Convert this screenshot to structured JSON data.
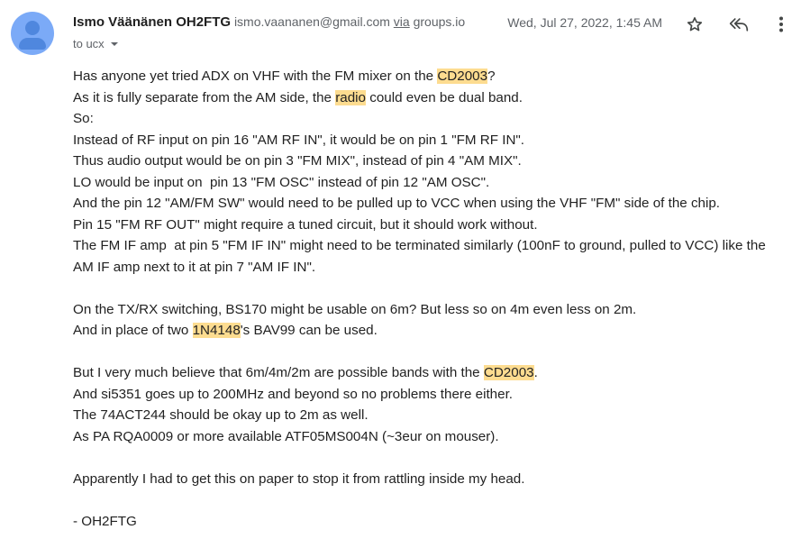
{
  "header": {
    "sender_name": "Ismo Väänänen OH2FTG",
    "sender_email": "ismo.vaananen@gmail.com",
    "via_word": "via",
    "via_domain": "groups.io",
    "date": "Wed, Jul 27, 2022, 1:45 AM",
    "to_label": "to ucx"
  },
  "icons": {
    "avatar": "person-avatar",
    "star": "star-icon",
    "reply": "reply-all-icon",
    "more": "more-vert-icon",
    "details": "chevron-down-icon"
  },
  "colors": {
    "highlight": "#fddc90",
    "avatar_bg": "#7baaf7",
    "avatar_fg": "#4f87de",
    "muted_text": "#5f6368"
  },
  "body": {
    "l1": [
      "Has anyone yet tried ADX on VHF with the FM mixer on the ",
      "CD2003",
      "?"
    ],
    "l2": [
      "As it is fully separate from the AM side, the ",
      "radio",
      " could even be dual band."
    ],
    "l3": "So:",
    "l4": "Instead of RF input on pin 16 \"AM RF IN\", it would be on pin 1 \"FM RF IN\".",
    "l5": "Thus audio output would be on pin 3 \"FM MIX\", instead of pin 4 \"AM MIX\".",
    "l6": "LO would be input on  pin 13 \"FM OSC\" instead of pin 12 \"AM OSC\".",
    "l7": "And the pin 12 \"AM/FM SW\" would need to be pulled up to VCC when using the VHF \"FM\" side of the chip.",
    "l8": "Pin 15 \"FM RF OUT\" might require a tuned circuit, but it should work without.",
    "l9": "The FM IF amp  at pin 5 \"FM IF IN\" might need to be terminated similarly (100nF to ground, pulled to VCC) like the",
    "l10": "AM IF amp next to it at pin 7 \"AM IF IN\".",
    "l11": "On the TX/RX switching, BS170 might be usable on 6m? But less so on 4m even less on 2m.",
    "l12": [
      "And in place of two ",
      "1N4148",
      "'s BAV99 can be used."
    ],
    "l13": [
      "But I very much believe that 6m/4m/2m are possible bands with the ",
      "CD2003",
      "."
    ],
    "l14": "And si5351 goes up to 200MHz and beyond so no problems there either.",
    "l15": "The 74ACT244 should be okay up to 2m as well.",
    "l16": "As PA RQA0009 or more available ATF05MS004N (~3eur on mouser).",
    "l17": "Apparently I had to get this on paper to stop it from rattling inside my head.",
    "l18": "- OH2FTG"
  }
}
